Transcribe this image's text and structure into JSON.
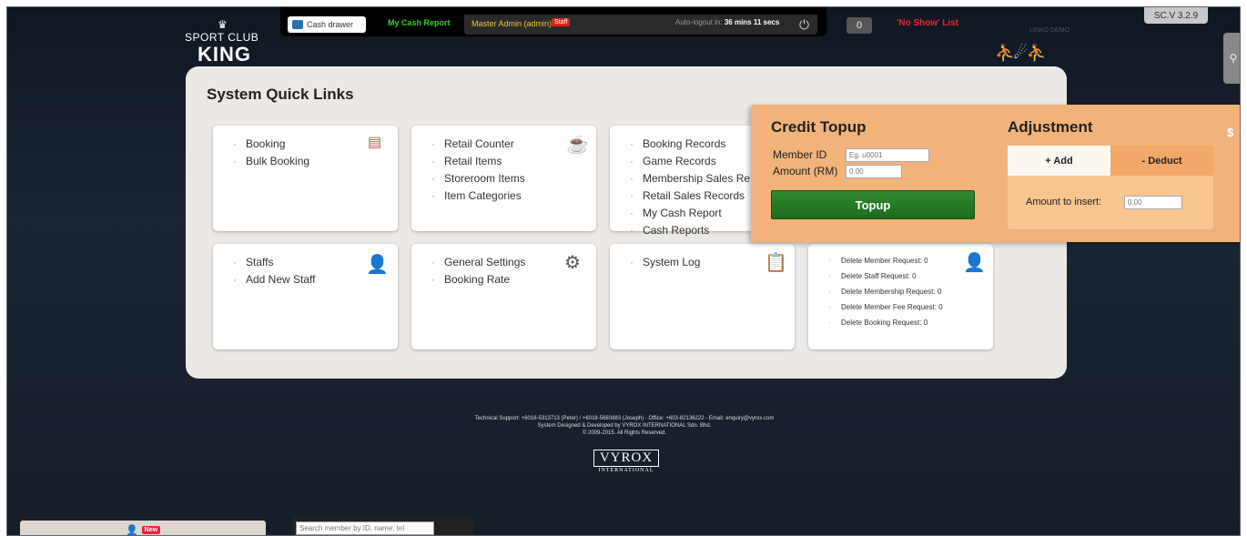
{
  "topbar": {
    "cash_drawer": "Cash drawer",
    "my_cash_report": "My Cash Report",
    "master_admin": "Master Admin (admin)",
    "staff_badge": "Staff",
    "auto_logout_label": "Auto-logout in:",
    "auto_logout_time": "36 mins 11 secs",
    "counter": "0",
    "no_show": "'No Show' List",
    "version": "SC.V 3.2.9",
    "demo": "LINKO DEMO"
  },
  "logo": {
    "line1": "SPORT CLUB",
    "line2": "KING"
  },
  "quick_links": {
    "title": "System Quick Links",
    "cards": [
      {
        "items": [
          "Booking",
          "Bulk Booking"
        ],
        "icon": "calendar-icon"
      },
      {
        "items": [
          "Retail Counter",
          "Retail Items",
          "Storeroom Items",
          "Item Categories"
        ],
        "icon": "retail-icon"
      },
      {
        "items": [
          "Booking Records",
          "Game Records",
          "Membership Sales Re",
          "Retail Sales Records",
          "My Cash Report",
          "Cash Reports"
        ],
        "icon": "records-icon"
      },
      {
        "items": [
          "Staffs",
          "Add New Staff"
        ],
        "icon": "staff-icon"
      },
      {
        "items": [
          "General Settings",
          "Booking Rate"
        ],
        "icon": "gear-icon"
      },
      {
        "items": [
          "System Log"
        ],
        "icon": "clipboard-icon"
      },
      {
        "items": [
          "Delete Member Request: 0",
          "Delete Staff Request: 0",
          "Delete Membership Request: 0",
          "Delete Member Fee Request: 0",
          "Delete Booking Request: 0"
        ],
        "icon": "request-icon"
      }
    ]
  },
  "credit_topup": {
    "title": "Credit Topup",
    "member_id_label": "Member ID",
    "member_id_placeholder": "Eg. u0001",
    "amount_label": "Amount (RM)",
    "amount_placeholder": "0.00",
    "topup_button": "Topup"
  },
  "adjustment": {
    "title": "Adjustment",
    "tab_add": "+ Add",
    "tab_deduct": "- Deduct",
    "amount_label": "Amount to insert:",
    "amount_placeholder": "0.00"
  },
  "footer": {
    "line1": "Technical Support: +6016-5313713 (Peter) / +6018-5680883 (Joseph) - Office: +603-82136222 - Email: enquiry@vyrox.com",
    "line2": "System Designed & Developed by VYROX INTERNATIONAL Sdn. Bhd.",
    "line3": "© 2009-2015. All Rights Reserved.",
    "brand": "VYROX",
    "brand_sub": "INTERNATIONAL"
  },
  "bottom": {
    "new_badge": "New",
    "search_placeholder": "Search member by ID, name, tel"
  }
}
